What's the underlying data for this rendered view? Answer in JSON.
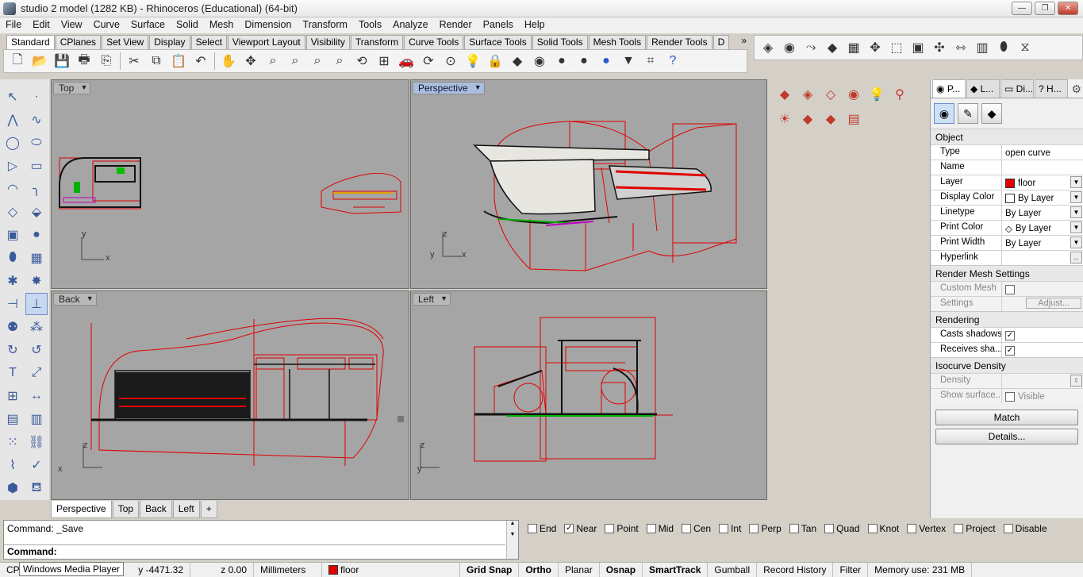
{
  "window": {
    "title": "studio 2 model (1282 KB) - Rhinoceros (Educational) (64-bit)"
  },
  "menu": [
    "File",
    "Edit",
    "View",
    "Curve",
    "Surface",
    "Solid",
    "Mesh",
    "Dimension",
    "Transform",
    "Tools",
    "Analyze",
    "Render",
    "Panels",
    "Help"
  ],
  "toolbar_tabs": [
    "Standard",
    "CPlanes",
    "Set View",
    "Display",
    "Select",
    "Viewport Layout",
    "Visibility",
    "Transform",
    "Curve Tools",
    "Surface Tools",
    "Solid Tools",
    "Mesh Tools",
    "Render Tools",
    "D"
  ],
  "toolbar_tab_overflow": "»",
  "standard_icons": [
    "new-file-icon",
    "open-icon",
    "save-icon",
    "print-icon",
    "import-icon",
    "cut-icon",
    "copy-icon",
    "paste-icon",
    "undo-icon",
    "pan-hand-icon",
    "rotate-view-icon",
    "zoom-icon",
    "zoom-window-icon",
    "zoom-extents-icon",
    "zoom-selected-icon",
    "rotate-icon",
    "four-viewports-icon",
    "car-icon",
    "redraw-icon",
    "select-point-icon",
    "light-bulb-icon",
    "lock-icon",
    "layer-icon",
    "color-wheel-icon",
    "sphere-shade-icon",
    "sphere-render-icon",
    "sphere-blue-icon",
    "filter-icon",
    "snapshot-icon",
    "help-icon"
  ],
  "viewports": {
    "top": {
      "label": "Top",
      "axis_y": "y",
      "axis_x": "x"
    },
    "perspective": {
      "label": "Perspective",
      "axis_z": "z",
      "axis_y": "y",
      "axis_x": "x"
    },
    "back": {
      "label": "Back",
      "axis_z": "z",
      "axis_x": "x"
    },
    "left": {
      "label": "Left",
      "axis_z": "z",
      "axis_y": "y"
    }
  },
  "viewport_tabs": [
    "Perspective",
    "Top",
    "Back",
    "Left"
  ],
  "viewport_tab_add": "+",
  "panel": {
    "tabs": [
      "P...",
      "L...",
      "Di...",
      "H..."
    ],
    "sections": {
      "object": "Object",
      "render_mesh": "Render Mesh Settings",
      "rendering": "Rendering",
      "isocurve": "Isocurve Density"
    },
    "object_rows": [
      {
        "key": "Type",
        "value": "open curve"
      },
      {
        "key": "Name",
        "value": ""
      },
      {
        "key": "Layer",
        "value": "floor",
        "swatch": "#e00000"
      },
      {
        "key": "Display Color",
        "value": "By Layer",
        "swatch": "#ffffff"
      },
      {
        "key": "Linetype",
        "value": "By Layer"
      },
      {
        "key": "Print Color",
        "value": "By Layer"
      },
      {
        "key": "Print Width",
        "value": "By Layer"
      },
      {
        "key": "Hyperlink",
        "value": ""
      }
    ],
    "hyperlink_button": "...",
    "custom_mesh": "Custom Mesh",
    "settings": "Settings",
    "adjust": "Adjust...",
    "casts_shadows": "Casts shadows",
    "receives_shadows": "Receives sha...",
    "density": "Density",
    "show_surface": "Show surface...",
    "visible": "Visible",
    "match": "Match",
    "details": "Details..."
  },
  "command": {
    "history": "Command: _Save",
    "prompt": "Command:"
  },
  "osnaps": [
    {
      "label": "End",
      "checked": false
    },
    {
      "label": "Near",
      "checked": true
    },
    {
      "label": "Point",
      "checked": false
    },
    {
      "label": "Mid",
      "checked": false
    },
    {
      "label": "Cen",
      "checked": false
    },
    {
      "label": "Int",
      "checked": false
    },
    {
      "label": "Perp",
      "checked": false
    },
    {
      "label": "Tan",
      "checked": false
    },
    {
      "label": "Quad",
      "checked": false
    },
    {
      "label": "Knot",
      "checked": false
    },
    {
      "label": "Vertex",
      "checked": false
    },
    {
      "label": "Project",
      "checked": false
    },
    {
      "label": "Disable",
      "checked": false
    }
  ],
  "status": {
    "cplane": "CP",
    "y": "y -4471.32",
    "z": "z 0.00",
    "units": "Millimeters",
    "layer": "floor",
    "layer_color": "#e00000",
    "toggles": [
      {
        "label": "Grid Snap",
        "on": true
      },
      {
        "label": "Ortho",
        "on": true
      },
      {
        "label": "Planar",
        "on": false
      },
      {
        "label": "Osnap",
        "on": true
      },
      {
        "label": "SmartTrack",
        "on": true
      },
      {
        "label": "Gumball",
        "on": false
      },
      {
        "label": "Record History",
        "on": false
      },
      {
        "label": "Filter",
        "on": false
      }
    ],
    "memory": "Memory use: 231 MB"
  },
  "tooltip": "Windows Media Player",
  "colors": {
    "viewport_bg": "#a5a5a5",
    "geometry": "#e00000",
    "active_viewport_label": "#aabede"
  }
}
